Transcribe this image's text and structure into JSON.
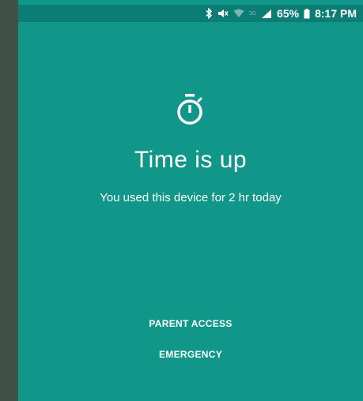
{
  "status_bar": {
    "icons": [
      "bluetooth-icon",
      "mute-icon",
      "wifi-icon",
      "signal-icon",
      "battery-icon"
    ],
    "network_label": "3G",
    "battery_percent": "65%",
    "time": "8:17 PM"
  },
  "main": {
    "icon": "timer-icon",
    "title": "Time is up",
    "subtitle": "You used this device for 2 hr today"
  },
  "actions": {
    "parent_access": "PARENT ACCESS",
    "emergency": "EMERGENCY"
  },
  "colors": {
    "background": "#11968a",
    "status_bar": "#0c7d74",
    "frame": "#3f5147",
    "text": "#ffffff"
  }
}
